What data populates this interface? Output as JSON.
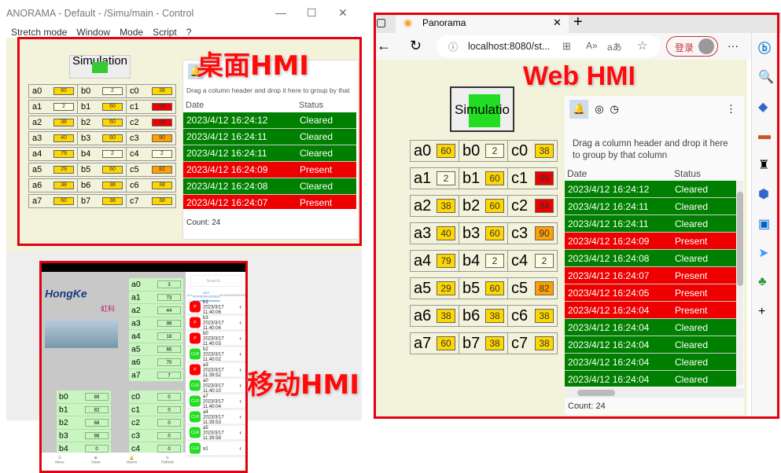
{
  "labels": {
    "desktop": "桌面HMI",
    "web": "Web HMI",
    "mobile": "移动HMI"
  },
  "desktop": {
    "title": "ANORAMA - Default - /Simu/main - Control",
    "menu": [
      "Stretch mode",
      "Window",
      "Mode",
      "Script",
      "?"
    ],
    "sim_label": "Simulation",
    "grid": [
      [
        [
          "a0",
          "60",
          "#ffd700"
        ],
        [
          "b0",
          "2",
          "#fffbe0"
        ],
        [
          "c0",
          "38",
          "#ffd700"
        ]
      ],
      [
        [
          "a1",
          "2",
          "#fffbe0"
        ],
        [
          "b1",
          "60",
          "#ffd700"
        ],
        [
          "c1",
          "99",
          "#f00000"
        ]
      ],
      [
        [
          "a2",
          "38",
          "#ffd700"
        ],
        [
          "b2",
          "60",
          "#ffd700"
        ],
        [
          "c2",
          "94",
          "#f00000"
        ]
      ],
      [
        [
          "a3",
          "40",
          "#ffd700"
        ],
        [
          "b3",
          "60",
          "#ffd700"
        ],
        [
          "c3",
          "90",
          "#ffa000"
        ]
      ],
      [
        [
          "a4",
          "79",
          "#ffd700"
        ],
        [
          "b4",
          "2",
          "#fffbe0"
        ],
        [
          "c4",
          "2",
          "#fffbe0"
        ]
      ],
      [
        [
          "a5",
          "29",
          "#ffd700"
        ],
        [
          "b5",
          "60",
          "#ffd700"
        ],
        [
          "c5",
          "82",
          "#ffa000"
        ]
      ],
      [
        [
          "a6",
          "38",
          "#ffd700"
        ],
        [
          "b6",
          "38",
          "#ffd700"
        ],
        [
          "c6",
          "38",
          "#ffd700"
        ]
      ],
      [
        [
          "a7",
          "60",
          "#ffd700"
        ],
        [
          "b7",
          "38",
          "#ffd700"
        ],
        [
          "c7",
          "38",
          "#ffd700"
        ]
      ]
    ],
    "alarm": {
      "hint": "Drag a column header and drop it here to group by that",
      "col_date": "Date",
      "col_status": "Status",
      "count": "Count: 24",
      "rows": [
        [
          "2023/4/12 16:24:12",
          "Cleared"
        ],
        [
          "2023/4/12 16:24:11",
          "Cleared"
        ],
        [
          "2023/4/12 16:24:11",
          "Cleared"
        ],
        [
          "2023/4/12 16:24:09",
          "Present"
        ],
        [
          "2023/4/12 16:24:08",
          "Cleared"
        ],
        [
          "2023/4/12 16:24:07",
          "Present"
        ]
      ]
    }
  },
  "web": {
    "tab_title": "Panorama",
    "url": "localhost:8080/st...",
    "login": "登录",
    "sim_label": "Simulatio",
    "alarm": {
      "hint": "Drag a column header and drop it here to group by that column",
      "col_date": "Date",
      "col_status": "Status",
      "count": "Count: 24",
      "rows": [
        [
          "2023/4/12 16:24:12",
          "Cleared"
        ],
        [
          "2023/4/12 16:24:11",
          "Cleared"
        ],
        [
          "2023/4/12 16:24:11",
          "Cleared"
        ],
        [
          "2023/4/12 16:24:09",
          "Present"
        ],
        [
          "2023/4/12 16:24:08",
          "Cleared"
        ],
        [
          "2023/4/12 16:24:07",
          "Present"
        ],
        [
          "2023/4/12 16:24:05",
          "Present"
        ],
        [
          "2023/4/12 16:24:04",
          "Present"
        ],
        [
          "2023/4/12 16:24:04",
          "Cleared"
        ],
        [
          "2023/4/12 16:24:04",
          "Cleared"
        ],
        [
          "2023/4/12 16:24:04",
          "Cleared"
        ],
        [
          "2023/4/12 16:24:04",
          "Cleared"
        ]
      ]
    }
  },
  "mobile": {
    "brand": "HongKe",
    "brand_cn": "虹科",
    "search": "Search",
    "tabs": [
      "ALL",
      "NOT ACKNOWLEDGED",
      "ACKNOWLEDGED"
    ],
    "a": [
      [
        "a0",
        "3"
      ],
      [
        "a1",
        "73"
      ],
      [
        "a2",
        "44"
      ],
      [
        "a3",
        "99"
      ],
      [
        "a4",
        "18"
      ],
      [
        "a5",
        "66"
      ],
      [
        "a6",
        "70"
      ],
      [
        "a7",
        "7"
      ]
    ],
    "b": [
      [
        "b0",
        "89"
      ],
      [
        "b1",
        "82"
      ],
      [
        "b2",
        "68"
      ],
      [
        "b3",
        "88"
      ],
      [
        "b4",
        "0"
      ],
      [
        "b5",
        "0"
      ],
      [
        "b6",
        "0"
      ],
      [
        "b7",
        "0"
      ]
    ],
    "c": [
      [
        "c0",
        "0"
      ],
      [
        "c1",
        "0"
      ],
      [
        "c2",
        "0"
      ],
      [
        "c3",
        "0"
      ],
      [
        "c4",
        "0"
      ],
      [
        "c5",
        "0"
      ],
      [
        "c6",
        "0"
      ],
      [
        "c7",
        "0"
      ]
    ],
    "alarms": [
      [
        "P",
        "b1",
        "2023/3/17 11:40:06"
      ],
      [
        "P",
        "b3",
        "2023/3/17 11:40:04"
      ],
      [
        "P",
        "b0",
        "2023/3/17 11:40:03"
      ],
      [
        "CLR",
        "b2",
        "2023/3/17 11:40:02"
      ],
      [
        "P",
        "a3",
        "2023/3/17 11:39:52"
      ],
      [
        "CLR",
        "a0",
        "2023/3/17 11:40:10"
      ],
      [
        "CLR",
        "a7",
        "2023/3/17 11:40:04"
      ],
      [
        "CLR",
        "a4",
        "2023/3/17 11:39:53"
      ],
      [
        "CLR",
        "a5",
        "2023/3/17 11:39:58"
      ],
      [
        "CLR",
        "a1",
        ""
      ]
    ],
    "nav": [
      "Menu",
      "Views",
      "Alarms",
      "Refresh"
    ]
  },
  "colors": {
    "cleared": "#008000",
    "present": "#ee0000",
    "accent": "#e3000f"
  }
}
